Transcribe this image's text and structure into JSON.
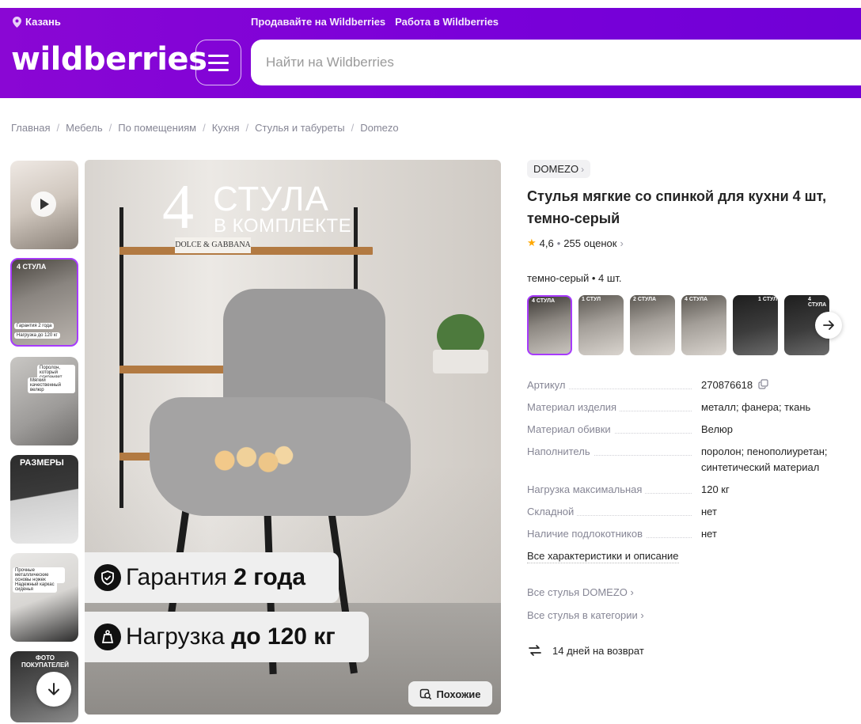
{
  "header": {
    "location": "Казань",
    "links": [
      "Продавайте на Wildberries",
      "Работа в Wildberries"
    ],
    "logo": "wildberries",
    "search_placeholder": "Найти на Wildberries"
  },
  "breadcrumbs": [
    "Главная",
    "Мебель",
    "По помещениям",
    "Кухня",
    "Стулья и табуреты",
    "Domezo"
  ],
  "gallery": {
    "thumb_labels": [
      "4 СТУЛА",
      "РАЗМЕРЫ",
      "ФОТО ПОКУПАТЕЛЕЙ"
    ],
    "thumb_small": [
      "Гарантия 2 года",
      "Нагрузка до 120 кг",
      "Поролон, который сохраняет форму",
      "Мягкий качественный велюр",
      "Прочные металлические основы ножек",
      "Надежный каркас сиденья"
    ],
    "main": {
      "box_text": "DOLCE & GABBANA",
      "number": "4",
      "headline": "СТУЛА",
      "subheadline": "В КОМПЛЕКТЕ",
      "badge1_prefix": "Гарантия ",
      "badge1_bold": "2 года",
      "badge2_prefix": "Нагрузка ",
      "badge2_bold": "до 120 кг",
      "similar": "Похожие"
    }
  },
  "product": {
    "brand": "DOMEZO",
    "title": "Стулья мягкие со спинкой для кухни 4 шт, темно-серый",
    "rating": "4,6",
    "reviews": "255 оценок",
    "variant": "темно-серый • 4 шт.",
    "variant_labels": [
      "4 СТУЛА",
      "1 СТУЛ",
      "2 СТУЛА",
      "4 СТУЛА",
      "1 СТУЛ",
      "4 СТУЛА"
    ],
    "specs": [
      {
        "k": "Артикул",
        "v": "270876618"
      },
      {
        "k": "Материал изделия",
        "v": "металл; фанера; ткань"
      },
      {
        "k": "Материал обивки",
        "v": "Велюр"
      },
      {
        "k": "Наполнитель",
        "v": "поролон; пенополиуретан; синтетический материал"
      },
      {
        "k": "Нагрузка максимальная",
        "v": "120 кг"
      },
      {
        "k": "Складной",
        "v": "нет"
      },
      {
        "k": "Наличие подлокотников",
        "v": "нет"
      }
    ],
    "all_specs_link": "Все характеристики и описание",
    "brand_link": "Все стулья DOMEZO",
    "category_link": "Все стулья в категории",
    "return_text": "14 дней на возврат"
  },
  "colors": {
    "accent": "#7a00d9",
    "selected_border": "#a73afd",
    "star": "#ffa800"
  }
}
